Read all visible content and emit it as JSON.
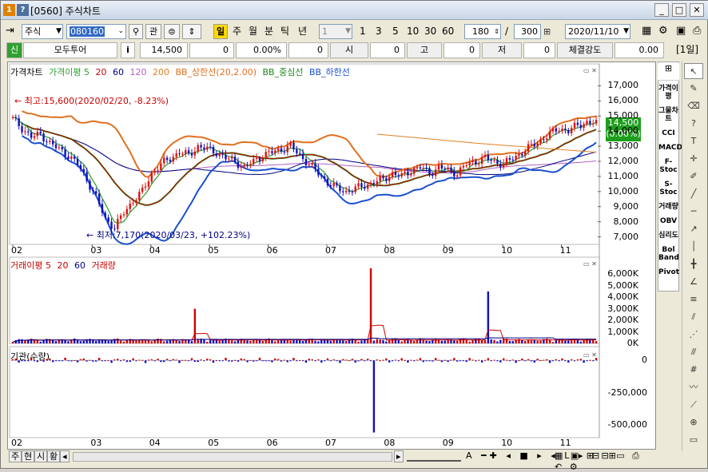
{
  "window": {
    "badge1": "1",
    "badge2": "?",
    "title": "[0560] 주식차트",
    "controls": [
      "_",
      "□",
      "✕"
    ]
  },
  "toolbar1": {
    "market": "주식",
    "code": "080160",
    "view_btn": "관",
    "period_btns": [
      "일",
      "주",
      "월",
      "분",
      "틱",
      "년"
    ],
    "interval_value": "1",
    "interval_btns": [
      "1",
      "3",
      "5",
      "10",
      "30",
      "60"
    ],
    "count_value": "180",
    "slash": "/",
    "max_value": "300",
    "date_value": "2020/11/10"
  },
  "toolbar2": {
    "credit_label": "신",
    "name": "모두투어",
    "info_btn": "i",
    "price": "14,500",
    "change": "0",
    "rate": "0.00%",
    "volume": "0",
    "open_label": "시",
    "open": "0",
    "high_label": "고",
    "high": "0",
    "low_label": "저",
    "low": "0",
    "strength_label": "체결강도",
    "strength": "0.00",
    "period_label": "[1일]"
  },
  "price_pane": {
    "legend": [
      {
        "text": "가격차트",
        "color": "#000000"
      },
      {
        "text": "가격이평 5",
        "color": "#2e9e2e"
      },
      {
        "text": "20",
        "color": "#cc0000"
      },
      {
        "text": "60",
        "color": "#000080"
      },
      {
        "text": "120",
        "color": "#b060c0"
      },
      {
        "text": "200",
        "color": "#e08020"
      },
      {
        "text": "BB_상한선(20,2.00)",
        "color": "#e07020"
      },
      {
        "text": "BB_중심선",
        "color": "#1a8a1a"
      },
      {
        "text": "BB_하한선",
        "color": "#1a50d0"
      }
    ],
    "high_note": "최고:15,600(2020/02/20, -8.23%)",
    "low_note": "최저:7,170(2020/03/23, +102.23%)",
    "last_price": "14,500",
    "last_rate": "(0.00%)",
    "y_ticks": [
      "17,000",
      "16,000",
      "15,000",
      "14,000",
      "13,000",
      "12,000",
      "11,000",
      "10,000",
      "9,000",
      "8,000",
      "7,000"
    ]
  },
  "volume_pane": {
    "legend": [
      {
        "text": "거래이평 5",
        "color": "#cc0000"
      },
      {
        "text": "20",
        "color": "#cc0000"
      },
      {
        "text": "60",
        "color": "#000080"
      },
      {
        "text": "거래량",
        "color": "#cc0000"
      }
    ],
    "y_ticks": [
      "6,000K",
      "5,000K",
      "4,000K",
      "3,000K",
      "2,000K",
      "1,000K",
      "0K"
    ]
  },
  "inst_pane": {
    "legend": [
      {
        "text": "기관(수량)",
        "color": "#000000"
      }
    ],
    "y_ticks": [
      "0",
      "-250,000",
      "-500,000"
    ]
  },
  "x_labels": [
    "02",
    "03",
    "04",
    "05",
    "06",
    "07",
    "08",
    "09",
    "10",
    "11"
  ],
  "right_indicators": [
    "가격이평",
    "그물차트",
    "CCI",
    "MACD",
    "F-Stoc",
    "S-Stoc",
    "거래량",
    "OBV",
    "심리도",
    "Bol Band",
    "Pivot"
  ],
  "bottom_tabs": [
    "주",
    "현",
    "시",
    "황"
  ],
  "chart_data": [
    {
      "type": "candlestick",
      "title": "가격차트",
      "x_ticks": [
        "02",
        "03",
        "04",
        "05",
        "06",
        "07",
        "08",
        "09",
        "10",
        "11"
      ],
      "ylim": [
        6500,
        17500
      ],
      "annotations": {
        "high": 15600,
        "low": 7170,
        "last": 14500
      },
      "close_series_approx": [
        14800,
        14200,
        13600,
        13800,
        13200,
        12800,
        12400,
        11800,
        10800,
        9600,
        8200,
        7600,
        8600,
        9400,
        10000,
        11200,
        11800,
        12200,
        12600,
        12400,
        13000,
        12800,
        12600,
        12200,
        12000,
        11600,
        12000,
        12400,
        12600,
        12800,
        13000,
        12400,
        11800,
        11200,
        10600,
        10200,
        10000,
        10200,
        10400,
        10600,
        10800,
        11200,
        11000,
        11400,
        11600,
        11200,
        11600,
        11400,
        11200,
        11800,
        12000,
        12200,
        12000,
        11800,
        12200,
        12600,
        13000,
        13400,
        13800,
        14200,
        14000,
        14400,
        14600,
        14500
      ]
    },
    {
      "type": "bar",
      "title": "거래량",
      "ylim": [
        0,
        6500
      ],
      "unit": "K",
      "peaks": [
        {
          "month": "05",
          "value": 3000
        },
        {
          "month": "08",
          "value": 6500
        },
        {
          "month": "10",
          "value": 4500
        }
      ]
    },
    {
      "type": "bar",
      "title": "기관(수량)",
      "ylim": [
        -600000,
        20000
      ],
      "min_value": -560000
    }
  ]
}
